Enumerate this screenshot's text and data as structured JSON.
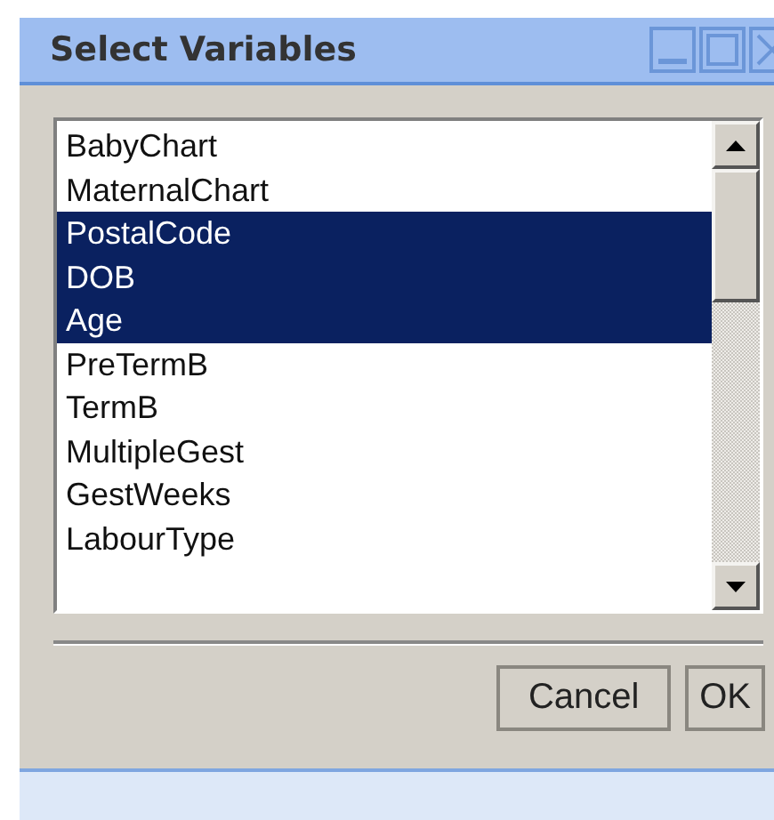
{
  "window": {
    "title": "Select Variables"
  },
  "list": {
    "items": [
      {
        "label": "BabyChart",
        "selected": false
      },
      {
        "label": "MaternalChart",
        "selected": false
      },
      {
        "label": "PostalCode",
        "selected": true
      },
      {
        "label": "DOB",
        "selected": true
      },
      {
        "label": "Age",
        "selected": true
      },
      {
        "label": "PreTermB",
        "selected": false
      },
      {
        "label": "TermB",
        "selected": false
      },
      {
        "label": "MultipleGest",
        "selected": false
      },
      {
        "label": "GestWeeks",
        "selected": false
      },
      {
        "label": "LabourType",
        "selected": false
      }
    ]
  },
  "buttons": [
    "Cancel",
    "OK"
  ]
}
